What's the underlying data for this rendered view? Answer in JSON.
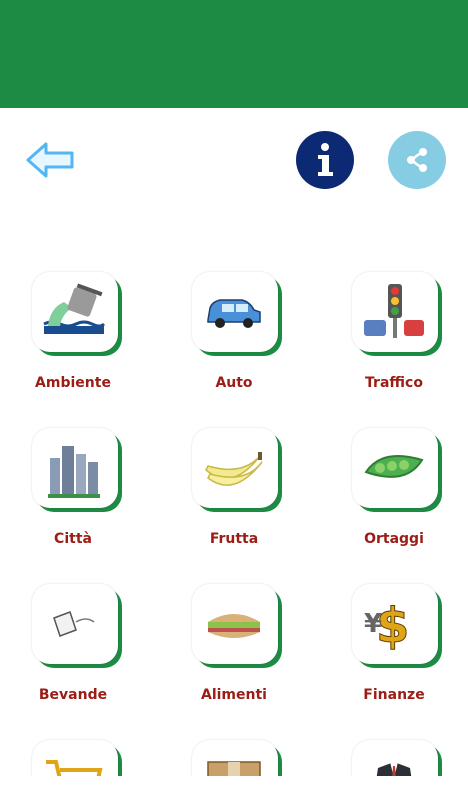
{
  "header": {
    "bar_color": "#1e8b45"
  },
  "toolbar": {
    "back_icon": "arrow-left-icon",
    "info_icon": "info-icon",
    "share_icon": "share-icon"
  },
  "colors": {
    "label": "#9c1c16",
    "accent": "#1e8b45",
    "info": "#0b2a73",
    "share": "#86cde3"
  },
  "categories": [
    {
      "label": "Ambiente",
      "icon": "environment-icon"
    },
    {
      "label": "Auto",
      "icon": "car-icon"
    },
    {
      "label": "Traffico",
      "icon": "traffic-light-icon"
    },
    {
      "label": "Città",
      "icon": "city-icon"
    },
    {
      "label": "Frutta",
      "icon": "banana-icon"
    },
    {
      "label": "Ortaggi",
      "icon": "peas-icon"
    },
    {
      "label": "Bevande",
      "icon": "glass-icon"
    },
    {
      "label": "Alimenti",
      "icon": "sandwich-icon"
    },
    {
      "label": "Finanze",
      "icon": "money-icon"
    },
    {
      "label": "",
      "icon": "shopping-cart-icon"
    },
    {
      "label": "",
      "icon": "box-icon"
    },
    {
      "label": "",
      "icon": "suit-icon"
    }
  ]
}
